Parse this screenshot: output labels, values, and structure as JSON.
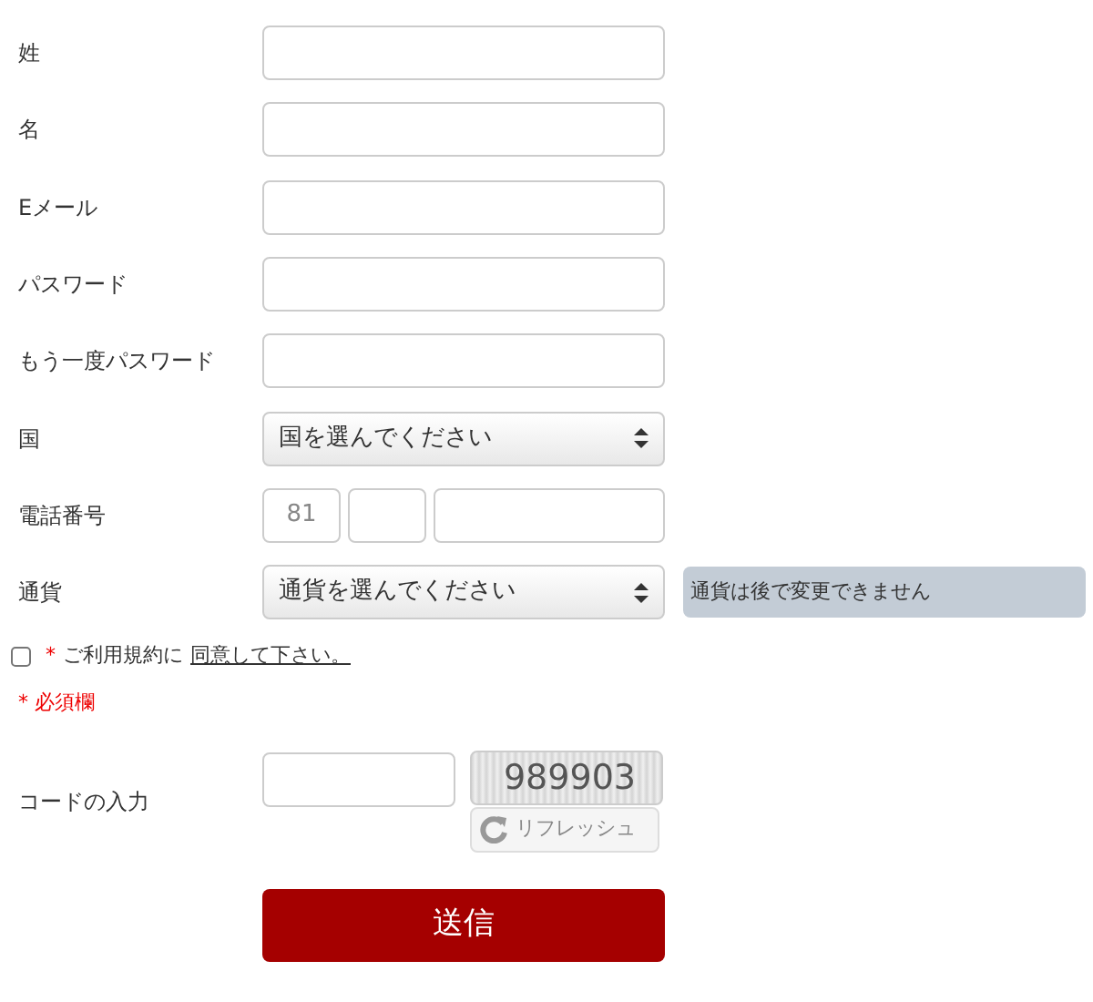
{
  "fields": [
    {
      "kind": "text",
      "label": "姓"
    },
    {
      "kind": "text",
      "label": "名"
    },
    {
      "kind": "text",
      "label": "Eメール"
    },
    {
      "kind": "password",
      "label": "パスワード"
    },
    {
      "kind": "password",
      "label": "もう一度パスワード"
    },
    {
      "kind": "select",
      "label": "国",
      "value": "国を選んでください"
    },
    {
      "kind": "phone",
      "label": "電話番号",
      "prefix": "81"
    },
    {
      "kind": "select",
      "label": "通貨",
      "value": "通貨を選んでください",
      "note": "通貨は後で変更できません"
    }
  ],
  "terms": {
    "checked": false,
    "mark": "*",
    "text": "ご利用規約に",
    "link": "同意して下さい。"
  },
  "required_note": "* 必須欄",
  "captcha": {
    "label": "コードの入力",
    "code": "989903",
    "refresh": "リフレッシュ"
  },
  "submit": "送信"
}
